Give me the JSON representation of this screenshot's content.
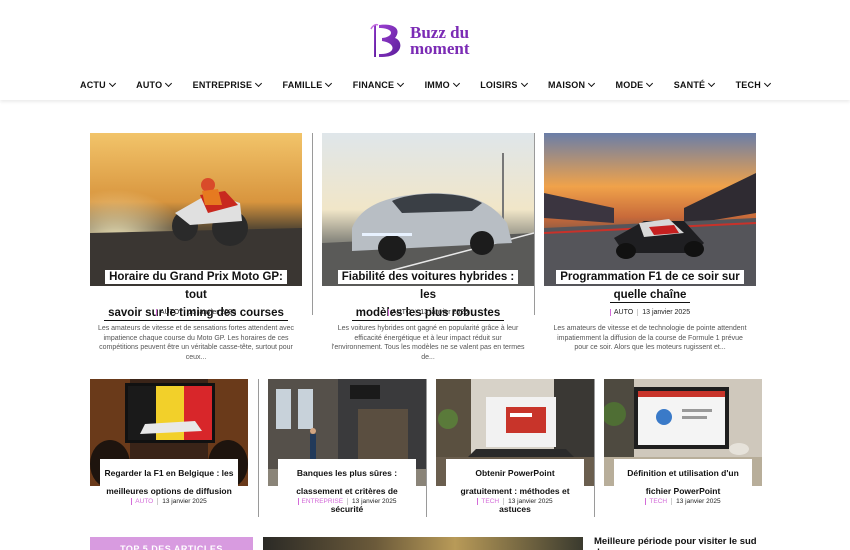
{
  "site": {
    "logo_text_line1": "Buzz du",
    "logo_text_line2": "moment",
    "brand_color": "#7b2bb5"
  },
  "nav": {
    "items": [
      "ACTU",
      "AUTO",
      "ENTREPRISE",
      "FAMILLE",
      "FINANCE",
      "IMMO",
      "LOISIRS",
      "MAISON",
      "MODE",
      "SANTÉ",
      "TECH"
    ],
    "icon": "chevron-down-icon"
  },
  "featured": [
    {
      "title_line1": "Horaire du Grand Prix Moto GP: tout",
      "title_line2": "savoir sur le timing des courses",
      "category": "AUTO",
      "date": "13 janvier 2025",
      "excerpt": "Les amateurs de vitesse et de sensations fortes attendent avec impatience chaque course du Moto GP. Les horaires de ces compétitions peuvent être un véritable casse-tête, surtout pour ceux..."
    },
    {
      "title_line1": "Fiabilité des voitures hybrides : les",
      "title_line2": "modèles les plus robustes",
      "category": "AUTO",
      "date": "13 janvier 2025",
      "excerpt": "Les voitures hybrides ont gagné en popularité grâce à leur efficacité énergétique et à leur impact réduit sur l'environnement. Tous les modèles ne se valent pas en termes de..."
    },
    {
      "title_line1": "Programmation F1 de ce soir sur",
      "title_line2": "quelle chaîne",
      "category": "AUTO",
      "date": "13 janvier 2025",
      "excerpt": "Les amateurs de vitesse et de technologie de pointe attendent impatiemment la diffusion de la course de Formule 1 prévue pour ce soir. Alors que les moteurs rugissent et..."
    }
  ],
  "secondary": [
    {
      "title": "Regarder la F1 en Belgique : les meilleures options de diffusion",
      "category": "AUTO",
      "date": "13 janvier 2025"
    },
    {
      "title": "Banques les plus sûres : classement et critères de sécurité",
      "category": "ENTREPRISE",
      "date": "13 janvier 2025"
    },
    {
      "title": "Obtenir PowerPoint gratuitement : méthodes et astuces",
      "category": "TECH",
      "date": "13 janvier 2025"
    },
    {
      "title": "Définition et utilisation d'un fichier PowerPoint",
      "category": "TECH",
      "date": "13 janvier 2025"
    }
  ],
  "bottom": {
    "top_articles_label": "TOP 5 DES ARTICLES",
    "next_title": "Meilleure période pour visiter le sud de"
  },
  "colors": {
    "category_accent": "#d36bd8",
    "top_articles_bg": "#d89be0"
  }
}
